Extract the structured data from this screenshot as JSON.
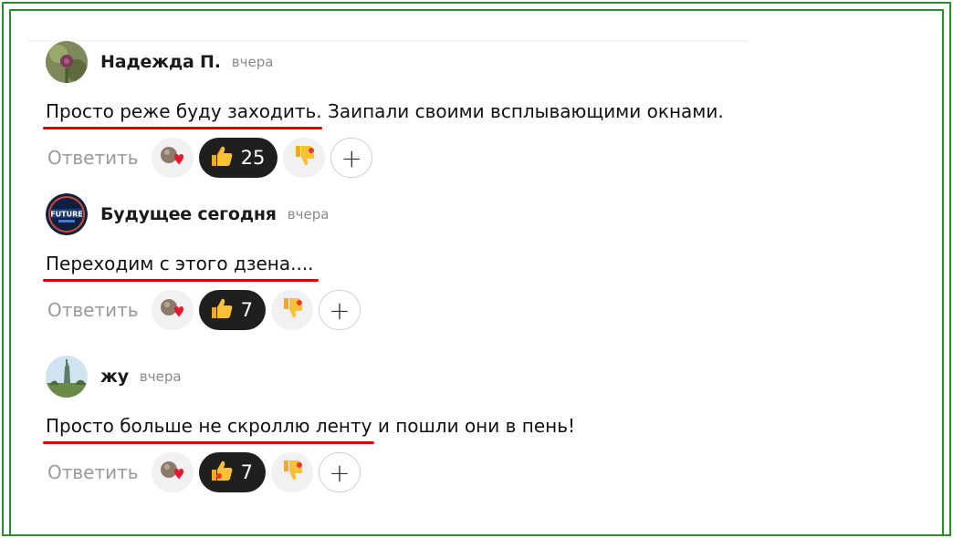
{
  "comments": [
    {
      "author": "Надежда П.",
      "time": "вчера",
      "text_underlined": "Просто реже буду заходить.",
      "text_rest": " Заипали своими всплывающими окнами.",
      "reply_label": "Ответить",
      "like_count": "25"
    },
    {
      "author": "Будущее сегодня",
      "time": "вчера",
      "text_underlined": "Переходим с этого дзена....",
      "text_rest": "",
      "reply_label": "Ответить",
      "like_count": "7",
      "avatar_text": "FUTURE"
    },
    {
      "author": "жу",
      "time": "вчера",
      "text_underlined": "Просто больше не скроллю ленту",
      "text_rest": " и пошли они в пень!",
      "reply_label": "Ответить",
      "like_count": "7"
    }
  ],
  "add_reaction_symbol": "+",
  "colors": {
    "frame": "#2e8b2e",
    "underline": "#e00000",
    "like_pill": "#1f1f1f",
    "reaction_pill": "#f1f1f1"
  },
  "icons": [
    "reactions-heart-icon",
    "thumbs-up-icon",
    "thumbs-down-icon",
    "plus-icon"
  ]
}
